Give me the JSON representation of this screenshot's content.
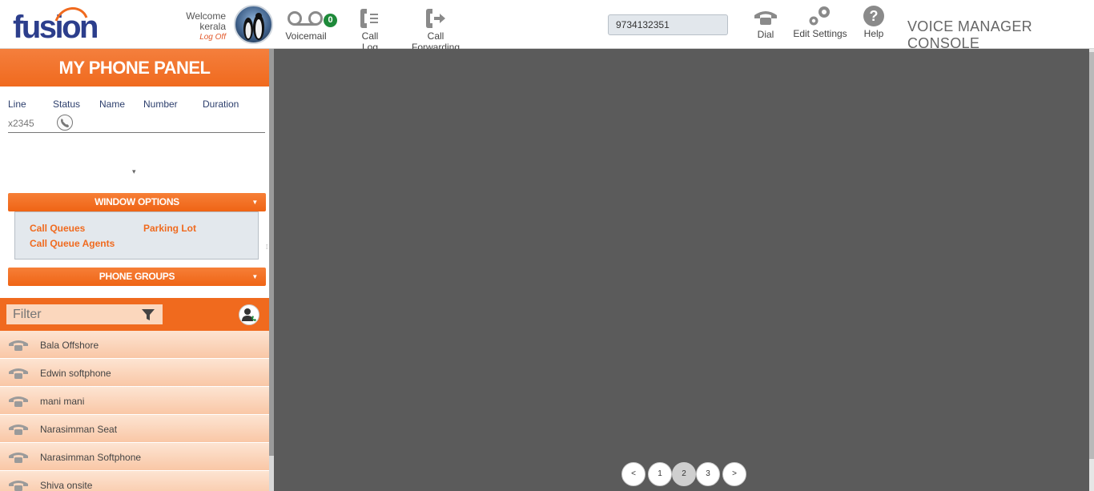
{
  "header": {
    "logo_text": "fusion",
    "welcome_label": "Welcome",
    "user_name": "kerala",
    "logoff_label": "Log Off",
    "voicemail_label": "Voicemail",
    "voicemail_count": "0",
    "call_log_label": "Call Log",
    "call_forwarding_label": "Call Forwarding",
    "dial_number": "9734132351",
    "dial_label": "Dial",
    "edit_settings_label": "Edit Settings",
    "help_label": "Help",
    "console_title": "VOICE MANAGER CONSOLE"
  },
  "panel": {
    "title": "MY PHONE PANEL",
    "columns": [
      "Line",
      "Status",
      "Name",
      "Number",
      "Duration"
    ],
    "line_ext": "x2345",
    "window_options_label": "WINDOW OPTIONS",
    "options": {
      "call_queues": "Call Queues",
      "parking_lot": "Parking Lot",
      "call_queue_agents": "Call Queue Agents"
    },
    "phone_groups_label": "PHONE GROUPS",
    "filter_placeholder": "Filter",
    "contacts": [
      "Bala Offshore",
      "Edwin softphone",
      "mani mani",
      "Narasimman Seat",
      "Narasimman Softphone",
      "Shiva onsite"
    ]
  },
  "pagination": {
    "prev": "<",
    "pages": [
      "1",
      "2",
      "3"
    ],
    "active": "2",
    "next": ">"
  },
  "colors": {
    "accent_orange": "#f06a1e",
    "logo_blue": "#2c3e8c",
    "main_bg": "#5b5b5b",
    "badge_green": "#1e8a3a"
  },
  "icons": {
    "voicemail": "voicemail-icon",
    "call_log": "call-log-icon",
    "call_forwarding": "call-forwarding-icon",
    "dial": "dial-phone-icon",
    "settings": "gears-icon",
    "help": "question-icon",
    "filter": "funnel-icon",
    "contacts": "contact-phone-icon"
  }
}
